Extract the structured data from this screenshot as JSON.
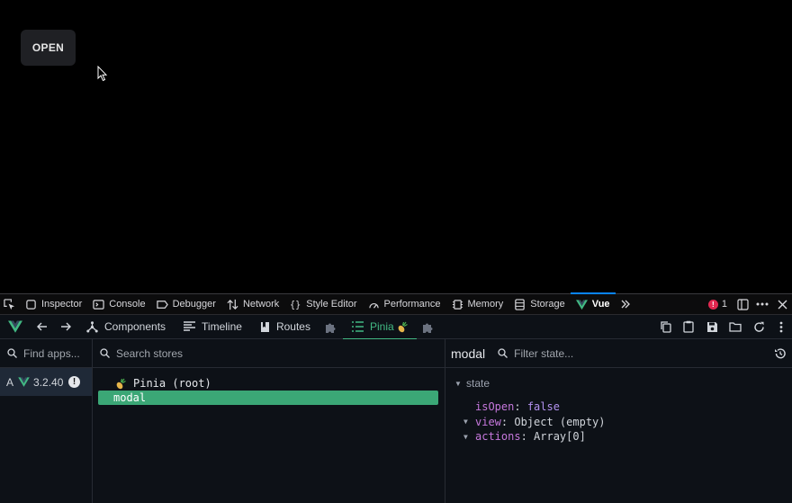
{
  "app": {
    "open_button_label": "OPEN"
  },
  "devtools_toolbar": {
    "tabs": [
      {
        "label": "Inspector",
        "icon": "inspector-icon"
      },
      {
        "label": "Console",
        "icon": "console-icon"
      },
      {
        "label": "Debugger",
        "icon": "debugger-icon"
      },
      {
        "label": "Network",
        "icon": "network-icon"
      },
      {
        "label": "Style Editor",
        "icon": "style-editor-icon"
      },
      {
        "label": "Performance",
        "icon": "performance-icon"
      },
      {
        "label": "Memory",
        "icon": "memory-icon"
      },
      {
        "label": "Storage",
        "icon": "storage-icon"
      },
      {
        "label": "Vue",
        "icon": "vue-logo-icon",
        "active": true
      }
    ],
    "error_count": "1",
    "colors": {
      "active_underline": "#0a84ff",
      "error": "#e22850"
    }
  },
  "vue_header": {
    "tabs": [
      {
        "label": "Components",
        "icon": "components-icon"
      },
      {
        "label": "Timeline",
        "icon": "timeline-icon"
      },
      {
        "label": "Routes",
        "icon": "routes-icon"
      },
      {
        "label": "Pinia",
        "icon": "list-icon",
        "active": true
      }
    ],
    "accent": "#42b883"
  },
  "apps_panel": {
    "search_placeholder": "Find apps...",
    "app_letter": "A",
    "app_version": "3.2.40",
    "warning": "!"
  },
  "stores_panel": {
    "search_placeholder": "Search stores",
    "stores": [
      {
        "label": "Pinia (root)"
      },
      {
        "label": "modal",
        "selected": true
      }
    ],
    "selected_color": "#3ba776"
  },
  "state_panel": {
    "title": "modal",
    "filter_placeholder": "Filter state...",
    "section": "state",
    "rows": [
      {
        "key": "isOpen",
        "value": "false"
      },
      {
        "key": "view",
        "value": "Object (empty)"
      },
      {
        "key": "actions",
        "value": "Array[0]"
      }
    ]
  }
}
